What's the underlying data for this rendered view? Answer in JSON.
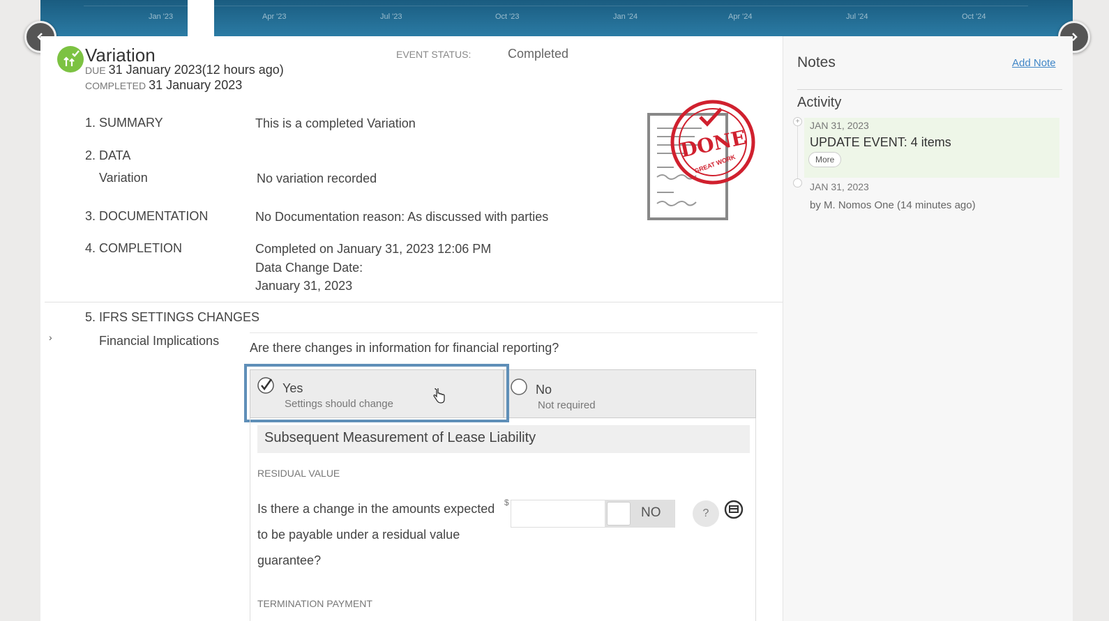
{
  "timeline": {
    "ticks": [
      "Jan '23",
      "Apr '23",
      "Jul '23",
      "Oct '23",
      "Jan '24",
      "Apr '24",
      "Jul '24",
      "Oct '24"
    ]
  },
  "event": {
    "title": "Variation",
    "due_label": "DUE",
    "due_value": "31 January 2023(12 hours ago)",
    "completed_label": "COMPLETED",
    "completed_value": "31 January 2023",
    "status_label": "EVENT STATUS:",
    "status_value": "Completed"
  },
  "sections": {
    "summary_label": "1. SUMMARY",
    "summary_value": "This is a completed Variation",
    "data_label": "2. DATA",
    "variation_label": "Variation",
    "variation_value": "No variation recorded",
    "documentation_label": "3. DOCUMENTATION",
    "documentation_value": "No Documentation reason: As discussed with parties",
    "completion_label": "4. COMPLETION",
    "completion_line1": "Completed on January 31, 2023 12:06 PM",
    "completion_line2": "Data Change Date:",
    "completion_line3": "January 31, 2023",
    "ifrs_label": "5. IFRS SETTINGS CHANGES",
    "financial_label": "Financial Implications"
  },
  "stamp": {
    "text_main": "DONE",
    "text_sub": "GREAT WORK",
    "color": "#d0202e"
  },
  "financial": {
    "question": "Are there changes in information for financial reporting?",
    "options": [
      {
        "title": "Yes",
        "subtitle": "Settings should change",
        "selected": true
      },
      {
        "title": "No",
        "subtitle": "Not required",
        "selected": false
      }
    ],
    "block_title": "Subsequent Measurement of Lease Liability",
    "residual_caption": "RESIDUAL VALUE",
    "residual_question": "Is there a change in the amounts expected to be payable under a residual value guarantee?",
    "currency": "$",
    "amount_value": "",
    "toggle_label": "NO",
    "help_label": "?",
    "termination_caption": "TERMINATION PAYMENT"
  },
  "notes": {
    "title": "Notes",
    "add_label": "Add Note",
    "activity_title": "Activity",
    "items": [
      {
        "date": "JAN 31, 2023",
        "text": "UPDATE EVENT: 4 items",
        "more": "More"
      },
      {
        "date": "JAN 31, 2023",
        "by": "by M. Nomos One (14 minutes ago)"
      }
    ]
  },
  "colors": {
    "accent": "#7cc242",
    "selection": "#5f8fb8",
    "link": "#3f86c7",
    "timeline": "#1f6890"
  },
  "icons": {
    "nav_prev": "chevron-left-icon",
    "nav_next": "chevron-right-icon",
    "event": "lease-event-icon",
    "check": "checkmark-icon",
    "comment": "comment-icon",
    "help": "question-icon"
  }
}
